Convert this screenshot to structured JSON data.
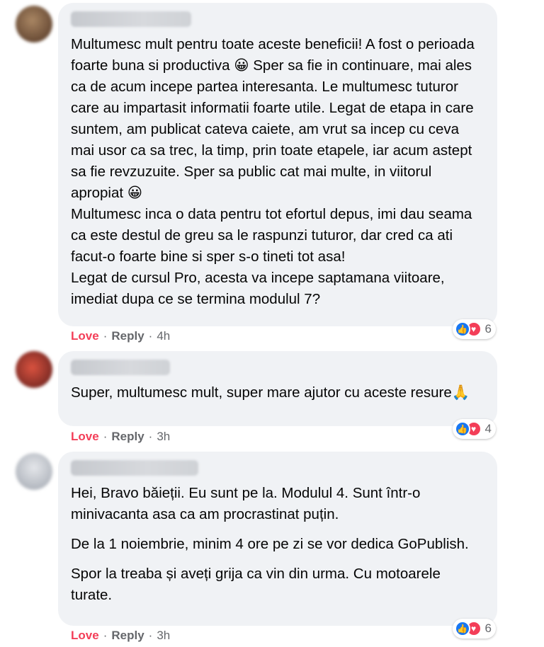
{
  "comments": [
    {
      "paragraphs": [
        "Multumesc mult pentru toate aceste beneficii! A fost o perioada foarte buna si productiva 😀 Sper sa fie in continuare, mai ales ca de acum incepe partea interesanta. Le multumesc tuturor care au impartasit informatii foarte utile. Legat de etapa in care suntem, am publicat cateva caiete, am vrut sa incep cu ceva mai usor ca sa trec, la timp, prin toate etapele, iar acum astept sa fie revzuzuite. Sper sa public cat mai multe, in viitorul apropiat 😀",
        "Multumesc inca o data pentru tot efortul depus, imi dau seama ca este destul de greu sa le raspunzi tuturor, dar cred ca ati facut-o foarte bine si sper s-o tineti tot asa!",
        "Legat de cursul Pro, acesta va incepe saptamana viitoare, imediat dupa ce se termina modulul 7?"
      ],
      "love_label": "Love",
      "reply_label": "Reply",
      "time": "4h",
      "reaction_count": "6",
      "avatar_color": "#8a6a4f"
    },
    {
      "paragraphs": [
        "Super, multumesc mult, super mare ajutor cu aceste resure🙏"
      ],
      "love_label": "Love",
      "reply_label": "Reply",
      "time": "3h",
      "reaction_count": "4",
      "avatar_color": "#b0443a"
    },
    {
      "paragraphs": [
        "Hei, Bravo băieții. Eu sunt pe la. Modulul 4. Sunt într-o minivacanta asa ca am procrastinat puțin.",
        "De la 1 noiembrie, minim 4 ore pe zi se vor dedica GoPublish.",
        "Spor la treaba și aveți grija ca vin din urma. Cu motoarele turate."
      ],
      "love_label": "Love",
      "reply_label": "Reply",
      "time": "3h",
      "reaction_count": "6",
      "avatar_color": "#c9ccd4"
    }
  ],
  "separator": "·",
  "like_icon": "thumbs-up-icon",
  "love_icon": "heart-icon",
  "colors": {
    "bubble": "#f0f2f5",
    "love_text": "#f33e58",
    "like_blue": "#1877f2",
    "meta_gray": "#65676b"
  }
}
